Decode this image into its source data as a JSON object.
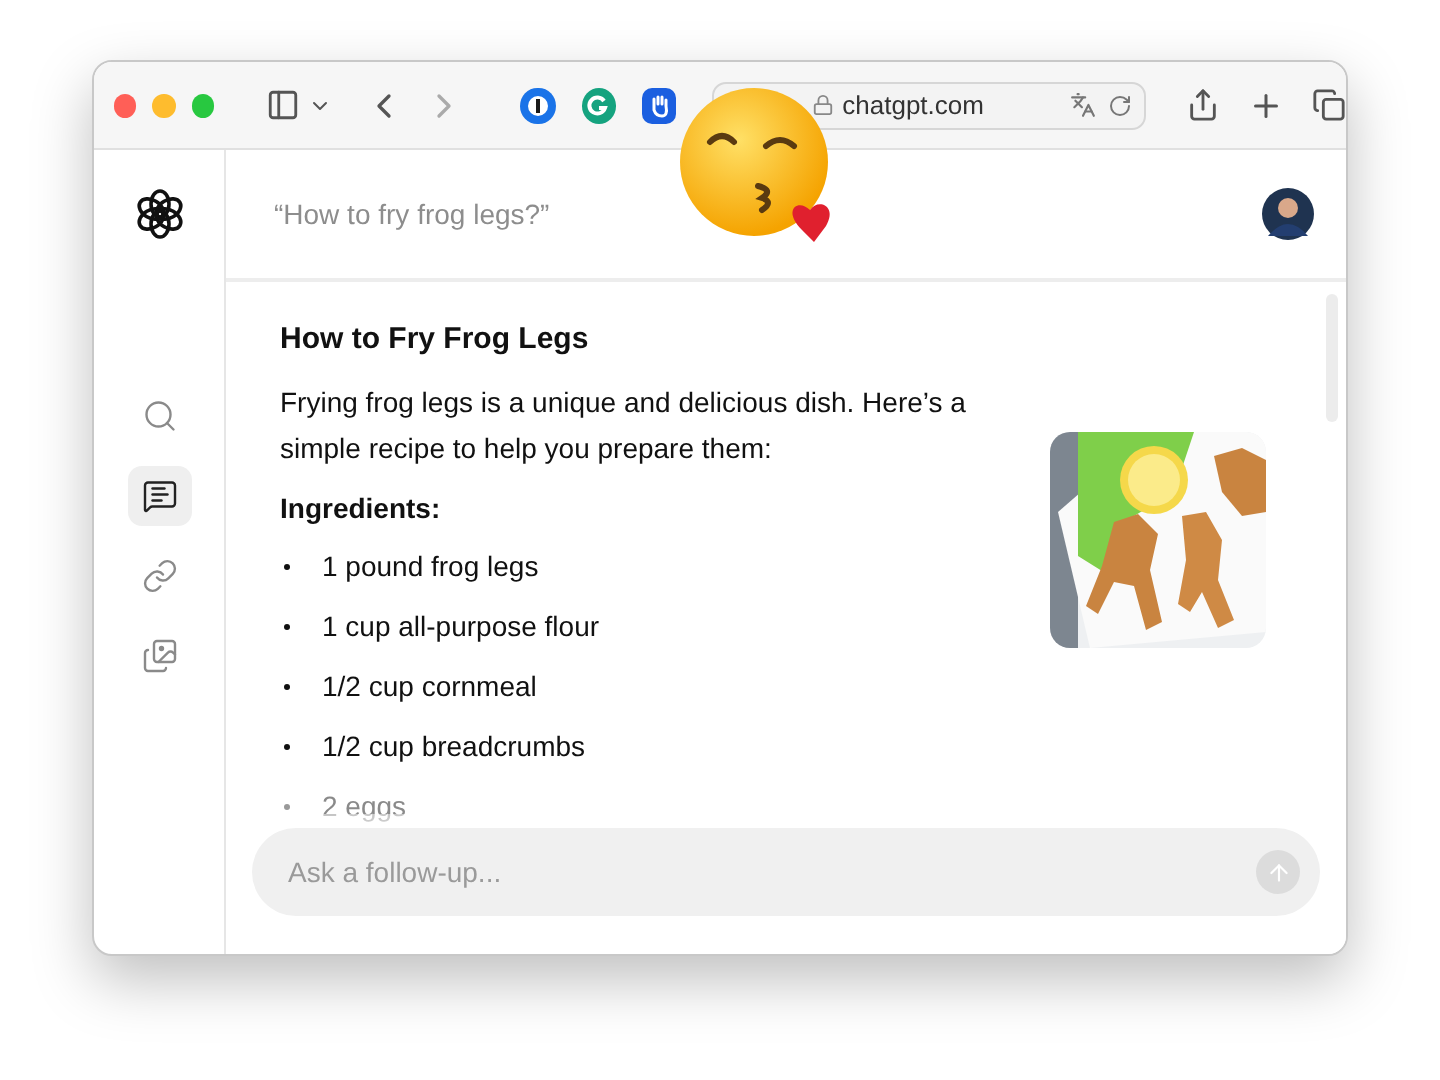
{
  "browser": {
    "url": "chatgpt.com"
  },
  "sidebar": {
    "items": [
      {
        "kind": "search",
        "selected": false
      },
      {
        "kind": "chat",
        "selected": true
      },
      {
        "kind": "link",
        "selected": false
      },
      {
        "kind": "images",
        "selected": false
      }
    ]
  },
  "header": {
    "query": "“How to fry frog legs?”"
  },
  "answer": {
    "title": "How to Fry Frog Legs",
    "intro": "Frying frog legs is a unique and delicious dish. Here’s a simple recipe to help you prepare them:",
    "section": "Ingredients:",
    "ingredients": [
      {
        "text": "1 pound frog legs",
        "faded": false
      },
      {
        "text": "1 cup all-purpose flour",
        "faded": false
      },
      {
        "text": "1/2 cup cornmeal",
        "faded": false
      },
      {
        "text": "1/2 cup breadcrumbs",
        "faded": false
      },
      {
        "text": "2 eggs",
        "faded": true
      }
    ]
  },
  "follow_up": {
    "placeholder": "Ask a follow-up..."
  }
}
